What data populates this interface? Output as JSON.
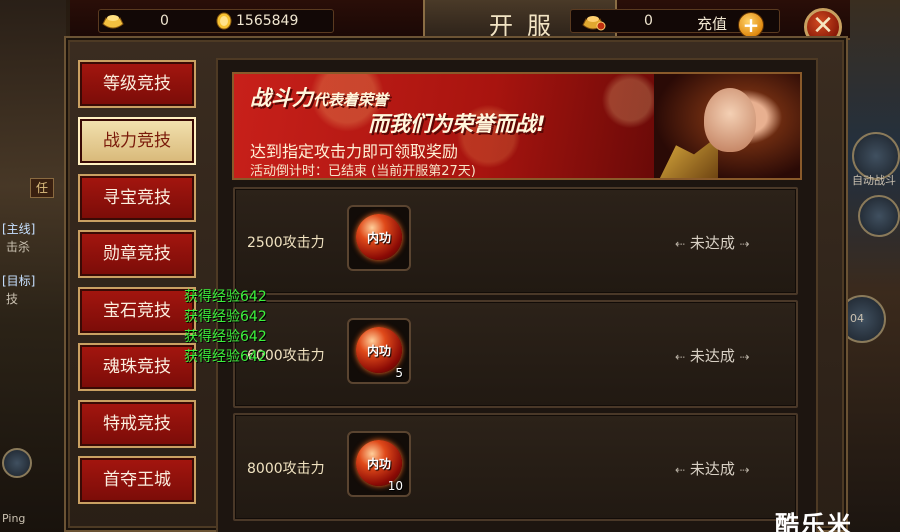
{
  "topbar": {
    "currency_ingot_value": "0",
    "currency_coin_value": "1565849",
    "title": "开服",
    "currency_bound_value": "0",
    "recharge_label": "充值",
    "plus_glyph": "+",
    "close_glyph": "✕"
  },
  "tabs": [
    {
      "label": "等级竞技",
      "active": false
    },
    {
      "label": "战力竞技",
      "active": true
    },
    {
      "label": "寻宝竞技",
      "active": false
    },
    {
      "label": "勋章竞技",
      "active": false
    },
    {
      "label": "宝石竞技",
      "active": false
    },
    {
      "label": "魂珠竞技",
      "active": false
    },
    {
      "label": "特戒竞技",
      "active": false
    },
    {
      "label": "首夺王城",
      "active": false
    }
  ],
  "banner": {
    "line1_a": "战斗力",
    "line1_b": "代表着荣誉",
    "line2": "而我们为荣誉而战!",
    "line3": "达到指定攻击力即可领取奖励",
    "line4": "活动倒计时：已结束 (当前开服第27天)"
  },
  "rows": [
    {
      "requirement": "2500攻击力",
      "item_label": "内功",
      "count": "",
      "status": "未达成"
    },
    {
      "requirement": "6000攻击力",
      "item_label": "内功",
      "count": "5",
      "status": "未达成"
    },
    {
      "requirement": "8000攻击力",
      "item_label": "内功",
      "count": "10",
      "status": "未达成"
    }
  ],
  "exp_messages": [
    "获得经验642",
    "获得经验642",
    "获得经验642",
    "获得经验642"
  ],
  "scene": {
    "chip_text": "任",
    "quest_main": "[主线]",
    "quest_kill": "击杀",
    "quest_target": "[目标]",
    "quest_tech": "技",
    "ping_label": "Ping",
    "right_auto": "自动战斗",
    "right_num": "04"
  },
  "watermark": "酷乐米",
  "colors": {
    "tab_red": "#a4160f",
    "tab_active": "#f3e2b0",
    "gold_border": "#caa062",
    "exp_green": "#3cf03c",
    "banner_red": "#c8201a"
  },
  "icons": [
    "gold-ingot-icon",
    "gold-coin-icon",
    "bound-ingot-icon",
    "plus-icon",
    "close-icon",
    "neigong-orb-icon",
    "arrow-left-icon",
    "arrow-right-icon"
  ]
}
